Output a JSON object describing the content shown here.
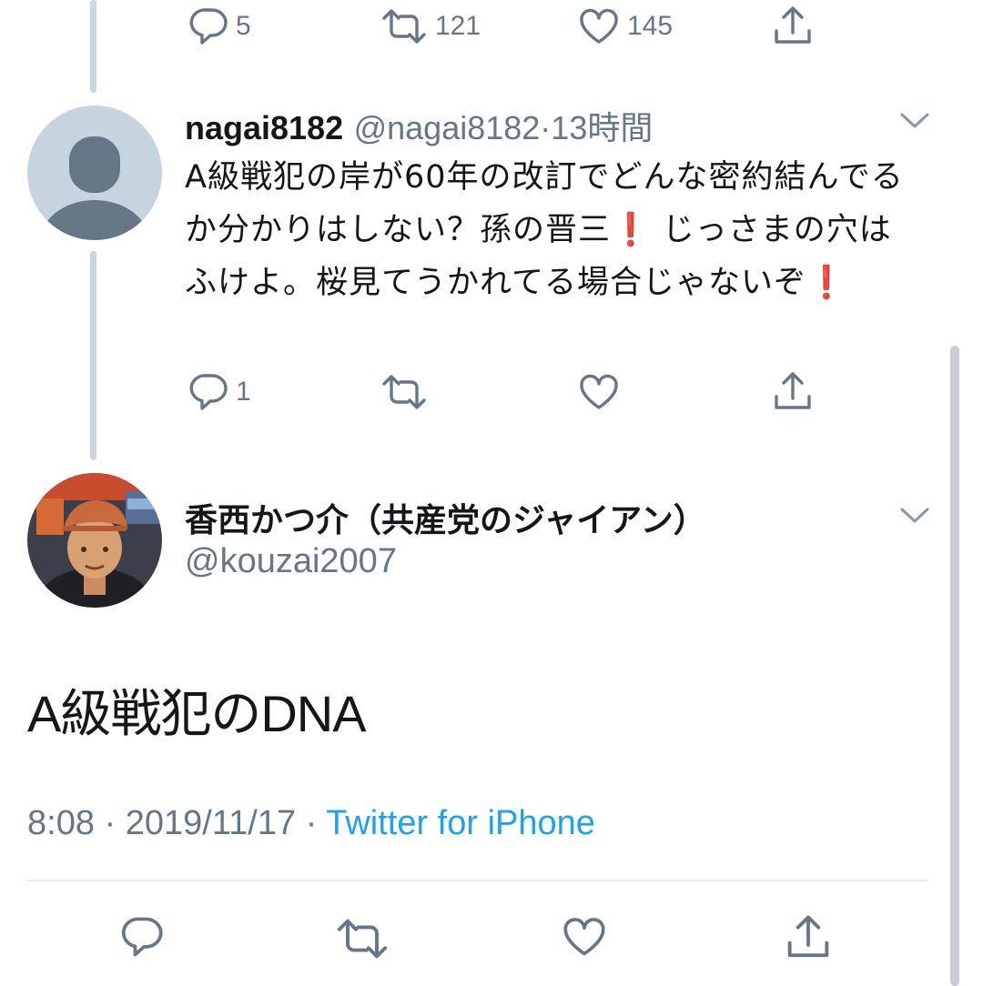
{
  "top_tweet_actions": {
    "reply_count": "5",
    "retweet_count": "121",
    "like_count": "145"
  },
  "reply_tweet": {
    "display_name": "nagai8182",
    "handle": "@nagai8182",
    "separator": "·",
    "time_ago": "13時間",
    "text_part1": "A級戦犯の岸が60年の改訂でどんな密約結んでるか分かりはしない？孫の晋三",
    "emoji": "❗",
    "text_part2": " じっさまの穴はふけよ。桜見てうかれてる場合じゃないぞ",
    "reply_count": "1"
  },
  "main_tweet": {
    "display_name": "香西かつ介（共産党のジャイアン）",
    "handle": "@kouzai2007",
    "text": "A級戦犯のDNA",
    "time": "8:08",
    "date": "2019/11/17",
    "separator": "·",
    "source": "Twitter for iPhone"
  },
  "colors": {
    "text_primary": "#14171a",
    "text_secondary": "#657786",
    "link": "#1da1f2",
    "thread_line": "#ccd6dd",
    "emoji_red": "#e0242b"
  },
  "icons": [
    "reply-icon",
    "retweet-icon",
    "like-icon",
    "share-icon",
    "chevron-down-icon",
    "default-avatar-icon"
  ]
}
